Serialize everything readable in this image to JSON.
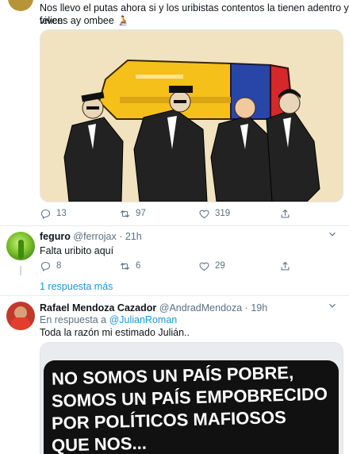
{
  "tweet1": {
    "text_line1": "Nos llevo el putas ahora si y los uribistas contentos la tienen adentro y viven",
    "text_line2": "felices ay ombee 🧑‍🦽",
    "replies": "13",
    "retweets": "97",
    "likes": "319"
  },
  "reply1": {
    "name": "feguro",
    "handle": "@ferrojax",
    "time": "21h",
    "text": "Falta uribito aquí",
    "replies": "8",
    "retweets": "6",
    "likes": "29"
  },
  "more_replies": "1 respuesta más",
  "reply2": {
    "name": "Rafael Mendoza Cazador",
    "handle": "@AndradMendoza",
    "time": "19h",
    "in_reply_prefix": "En respuesta a",
    "in_reply_user": "@JulianRoman",
    "text": "Toda la razón mi estimado Julián..",
    "image_lines": [
      "NO SOMOS UN PAÍS POBRE,",
      "SOMOS UN PAÍS EMPOBRECIDO",
      "POR POLÍTICOS MAFIOSOS",
      "QUE NOS..."
    ]
  },
  "colors": {
    "link": "#1b95e0",
    "muted": "#5b7083",
    "flag_yellow": "#f6c01a",
    "flag_blue": "#2746a8",
    "flag_red": "#d5282b"
  }
}
